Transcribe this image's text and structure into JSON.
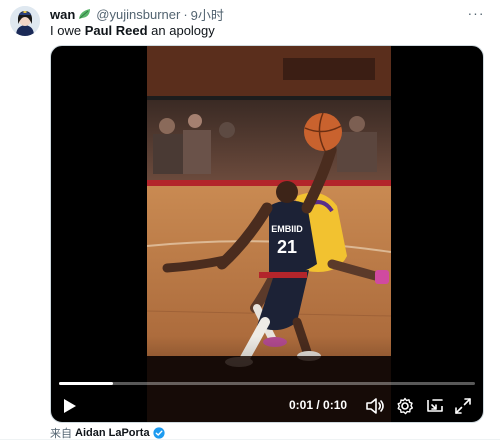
{
  "tweet": {
    "display_name": "wan",
    "handle": "@yujinsburner",
    "separator": "·",
    "time": "9小时",
    "text_before": "I owe ",
    "text_bold": "Paul Reed",
    "text_after": " an apology",
    "more_label": "···"
  },
  "video": {
    "current_time": "0:01",
    "time_divider": " / ",
    "duration": "0:10",
    "progress": 0.13,
    "jersey_name": "EMBIID",
    "jersey_number": "21"
  },
  "footer": {
    "from_label": "来自",
    "source_name": "Aidan LaPorta"
  },
  "colors": {
    "accent_blue": "#1d9bf0",
    "muted_text": "#536471",
    "leaf_green": "#59b56a"
  },
  "icons": {
    "leaf": "leaf-icon",
    "play": "play-icon",
    "volume": "volume-icon",
    "settings": "settings-icon",
    "pip": "picture-in-picture-icon",
    "fullscreen": "fullscreen-icon",
    "verified": "verified-badge-icon",
    "more": "more-icon"
  }
}
